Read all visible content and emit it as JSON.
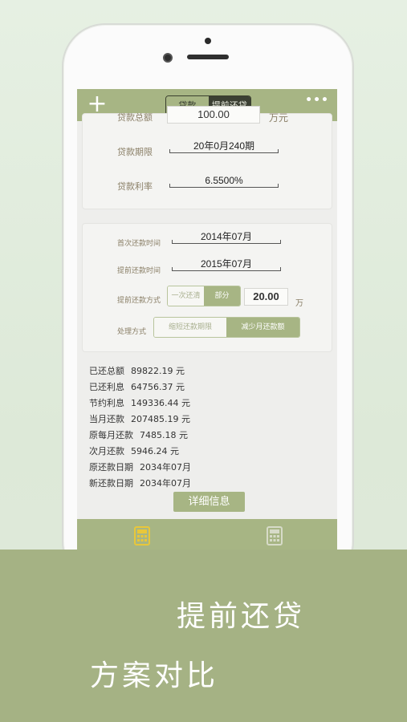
{
  "navbar": {
    "add_icon": "plus-icon",
    "tabs": [
      {
        "label": "贷款",
        "selected": false
      },
      {
        "label": "提前还贷",
        "selected": true
      }
    ],
    "more_icon": "ellipsis-icon",
    "more_text": "•••"
  },
  "loan": {
    "amount_label": "贷款总额",
    "amount_value": "100.00",
    "amount_unit": "万元",
    "term_label": "贷款期限",
    "term_value": "20年0月240期",
    "rate_label": "贷款利率",
    "rate_value": "6.5500%"
  },
  "prepay": {
    "first_payment_label": "首次还款时间",
    "first_payment_value": "2014年07月",
    "prepay_time_label": "提前还款时间",
    "prepay_time_value": "2015年07月",
    "method_label": "提前还款方式",
    "method_options": [
      {
        "label": "一次还清",
        "selected": false
      },
      {
        "label": "部分",
        "selected": true
      }
    ],
    "partial_amount": "20.00",
    "partial_unit": "万",
    "handling_label": "处理方式",
    "handling_options": [
      {
        "label": "缩短还款期限",
        "selected": false
      },
      {
        "label": "减少月还款额",
        "selected": true
      }
    ]
  },
  "results": [
    {
      "label": "已还总额",
      "value": "89822.19 元"
    },
    {
      "label": "已还利息",
      "value": "64756.37 元"
    },
    {
      "label": "节约利息",
      "value": "149336.44 元"
    },
    {
      "label": "当月还款",
      "value": "207485.19 元"
    },
    {
      "label": "原每月还款",
      "value": "7485.18 元"
    },
    {
      "label": "次月还款",
      "value": "5946.24 元"
    },
    {
      "label": "原还款日期",
      "value": "2034年07月"
    },
    {
      "label": "新还款日期",
      "value": "2034年07月"
    }
  ],
  "detail_button": "详细信息",
  "tabbar": {
    "items": [
      {
        "icon": "calculator-icon",
        "active": true,
        "color": "#e8c73a"
      },
      {
        "icon": "calculator-icon",
        "active": false,
        "color": "#d7dbc8"
      }
    ]
  },
  "banner": {
    "line1": "提前还贷",
    "line2": "方案对比"
  },
  "colors": {
    "accent": "#a7b584",
    "banner": "#a5b284",
    "label": "#8a7f67"
  }
}
